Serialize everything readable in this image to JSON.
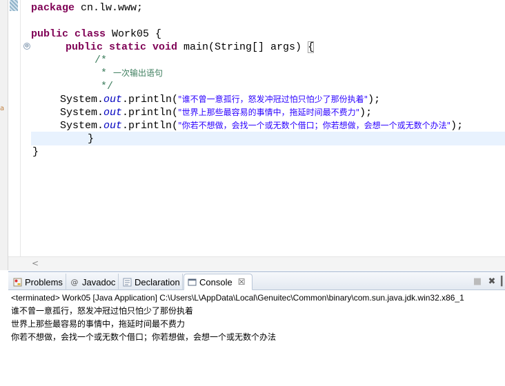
{
  "editor": {
    "fold_symbol": "⊖",
    "lines": {
      "package_kw": "package",
      "package_name": " cn.lw.www;",
      "class_kw": "public class",
      "class_name": " Work05 {",
      "method_kw": "public static void",
      "method_sig": " main(String[] args) ",
      "method_brace": "{",
      "comment_open": "/*",
      "comment_body_prefix": " * ",
      "comment_body_text": "一次输出语句",
      "comment_close": " */",
      "stmt_prefix": "System.",
      "stmt_field": "out",
      "stmt_call": ".println(",
      "stmt_end": ");",
      "string_1": "\"谁不曾一意孤行，怒发冲冠过怕只怕少了那份执着\"",
      "string_2": "\"世界上那些最容易的事情中，拖延时间最不费力\"",
      "string_3": "\"你若不想做，会找一个或无数个借口；你若想做，会想一个或无数个办法\"",
      "method_close": "}",
      "class_close": "}"
    },
    "left_marker": "a",
    "scroll_left_arrow": "<"
  },
  "console": {
    "tabs": [
      {
        "label": "Problems",
        "icon": "problems-icon"
      },
      {
        "label": "Javadoc",
        "icon": "at-icon"
      },
      {
        "label": "Declaration",
        "icon": "declaration-icon"
      },
      {
        "label": "Console",
        "icon": "console-icon",
        "close": "☒"
      }
    ],
    "toolbar": {
      "stop": "■",
      "remove": "✖",
      "more": "▎"
    },
    "terminated_line": "<terminated> Work05 [Java Application] C:\\Users\\L\\AppData\\Local\\Genuitec\\Common\\binary\\com.sun.java.jdk.win32.x86_1",
    "output": [
      "谁不曾一意孤行，怒发冲冠过怕只怕少了那份执着",
      "世界上那些最容易的事情中，拖延时间最不费力",
      "你若不想做，会找一个或无数个借口；你若想做，会想一个或无数个办法"
    ]
  },
  "colors": {
    "keyword": "#7f0055",
    "string": "#2a00ff",
    "field": "#0000c0",
    "comment": "#3f7f5f",
    "current_line": "#e8f2fe"
  }
}
